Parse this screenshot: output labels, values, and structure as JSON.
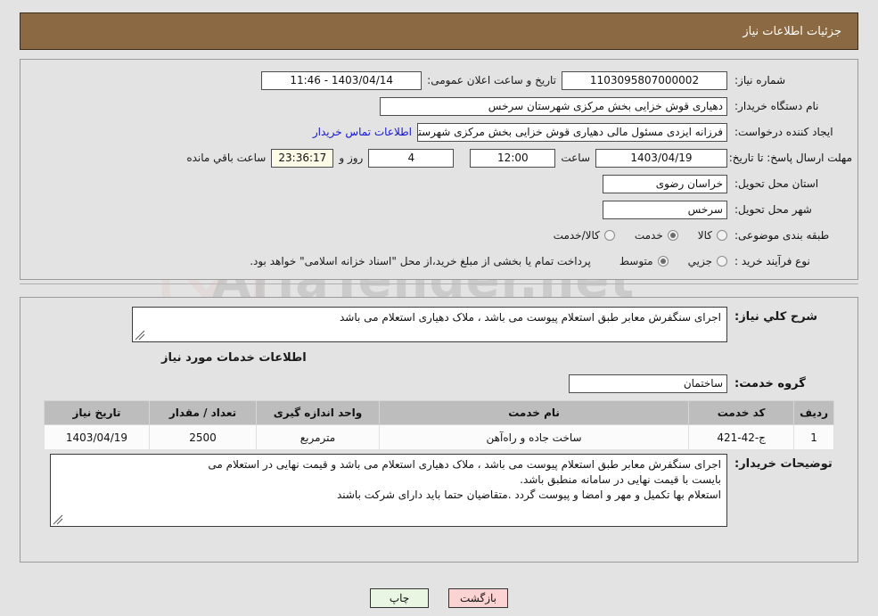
{
  "header": {
    "title": "جزئیات اطلاعات نیاز"
  },
  "need_info": {
    "need_number_label": "شماره نیاز:",
    "need_number_value": "1103095807000002",
    "public_announce_label": "تاریخ و ساعت اعلان عمومی:",
    "public_announce_value": "11:46 - 1403/04/14",
    "buyer_org_label": "نام دستگاه خریدار:",
    "buyer_org_value": "دهیاری قوش خزایی بخش مرکزی شهرستان سرخس",
    "creator_label": "ایجاد کننده درخواست:",
    "creator_value": "فرزانه ایزدی مسئول مالی دهیاری قوش خزایی بخش مرکزی شهرستان سرخس",
    "buyer_contact_link": "اطلاعات تماس خریدار",
    "deadline_label": "مهلت ارسال پاسخ: تا تاریخ:",
    "deadline_date": "1403/04/19",
    "deadline_time_label": "ساعت",
    "deadline_time": "12:00",
    "remaining_days": "4",
    "remaining_days_label": "روز و",
    "remaining_clock": "23:36:17",
    "remaining_clock_label": "ساعت باقي مانده",
    "province_label": "استان محل تحویل:",
    "province_value": "خراسان رضوی",
    "city_label": "شهر محل تحویل:",
    "city_value": "سرخس",
    "classification_label": "طبقه بندی موضوعی:",
    "classification_options": [
      {
        "label": "کالا",
        "selected": false
      },
      {
        "label": "خدمت",
        "selected": true
      },
      {
        "label": "کالا/خدمت",
        "selected": false
      }
    ],
    "process_type_label": "نوع فرآیند خرید :",
    "process_type_options": [
      {
        "label": "جزیي",
        "selected": false
      },
      {
        "label": "متوسط",
        "selected": true
      }
    ],
    "payment_note": "پرداخت تمام یا بخشی از مبلغ خرید،از محل \"اسناد خزانه اسلامی\" خواهد بود."
  },
  "description": {
    "label": "شرح کلي نیاز:",
    "value": "اجرای سنگفرش معابر طبق استعلام پیوست می باشد ، ملاک دهیاری استعلام می باشد"
  },
  "services": {
    "section_title": "اطلاعات خدمات مورد نیاز",
    "group_label": "گروه خدمت:",
    "group_value": "ساختمان",
    "table": {
      "columns": [
        "ردیف",
        "کد خدمت",
        "نام خدمت",
        "واحد اندازه گیری",
        "تعداد / مقدار",
        "تاریخ نیاز"
      ],
      "rows": [
        {
          "row_no": "1",
          "service_code": "ج-42-421",
          "service_name": "ساخت جاده و راه‌آهن",
          "unit": "مترمربع",
          "quantity": "2500",
          "need_date": "1403/04/19"
        }
      ]
    }
  },
  "buyer_notes": {
    "label": "توضیحات خریدار:",
    "line1": "اجرای سنگفرش معابر طبق استعلام پیوست می باشد ، ملاک دهیاری استعلام می باشد و قیمت نهایی در استعلام می",
    "line2": "بایست با قیمت نهایی در سامانه منطبق باشد.",
    "line3": "استعلام بها تکمیل و مهر و امضا و پیوست گردد .متقاضیان حتما باید دارای شرکت باشند"
  },
  "footer": {
    "back_label": "بازگشت",
    "print_label": "چاپ"
  },
  "watermark": {
    "text": "AriaTender.net"
  },
  "colors": {
    "header_brown": "#8b6a43",
    "link_blue": "#1414d2",
    "back_button": "#fbd3d3",
    "print_button": "#e8f6e2",
    "countdown_bg": "#fbfbe8",
    "table_header": "#bdbdbd"
  }
}
